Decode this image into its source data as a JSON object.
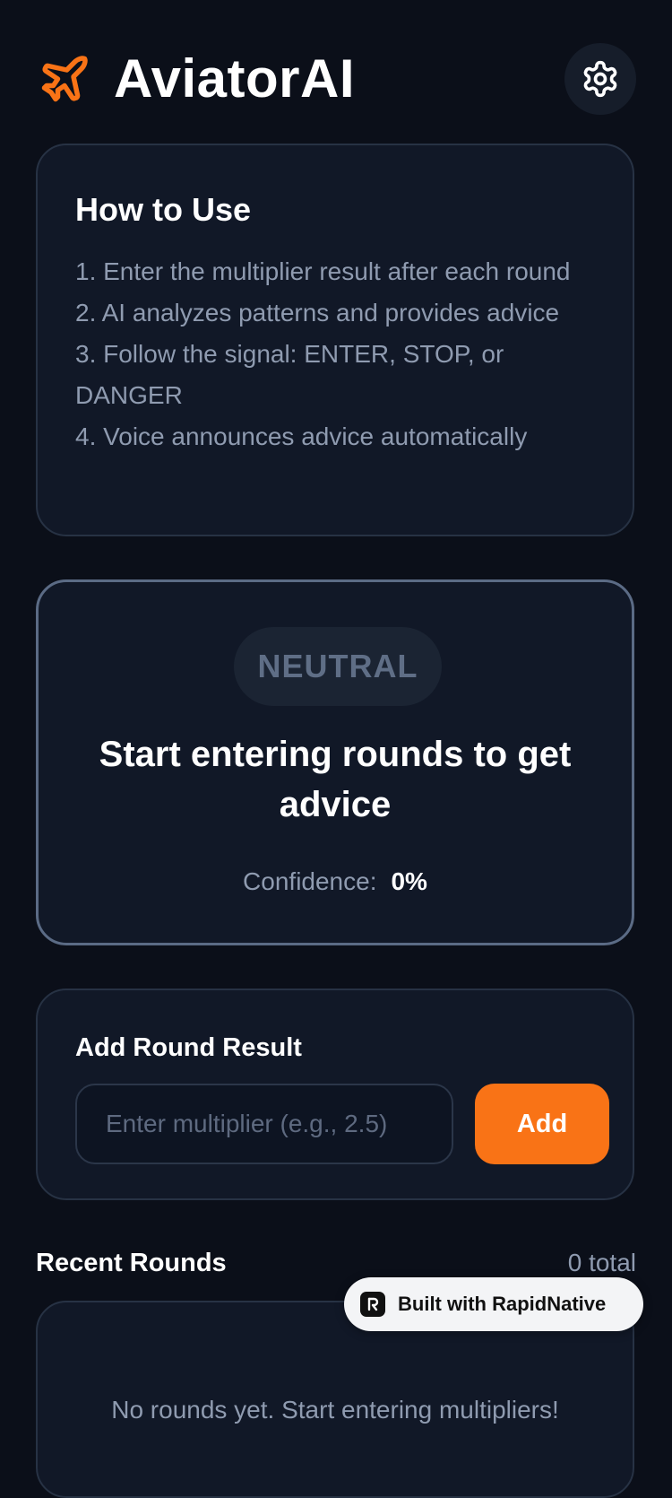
{
  "header": {
    "app_name": "AviatorAI",
    "logo_icon": "airplane-icon",
    "settings_icon": "gear-icon",
    "accent_color": "#f97316"
  },
  "how_to_use": {
    "title": "How to Use",
    "steps": [
      "1. Enter the multiplier result after each round",
      "2. AI analyzes patterns and provides advice",
      "3. Follow the signal: ENTER, STOP, or DANGER",
      "4. Voice announces advice automatically"
    ]
  },
  "signal": {
    "status": "NEUTRAL",
    "message": "Start entering rounds to get advice",
    "confidence_label": "Confidence:",
    "confidence_value": "0%"
  },
  "add_round": {
    "title": "Add Round Result",
    "input_placeholder": "Enter multiplier (e.g., 2.5)",
    "input_value": "",
    "button_label": "Add"
  },
  "recent_rounds": {
    "title": "Recent Rounds",
    "count_text": "0 total",
    "empty_message": "No rounds yet. Start entering multipliers!"
  },
  "badge": {
    "label": "Built with RapidNative",
    "icon": "rapidnative-logo-icon"
  }
}
